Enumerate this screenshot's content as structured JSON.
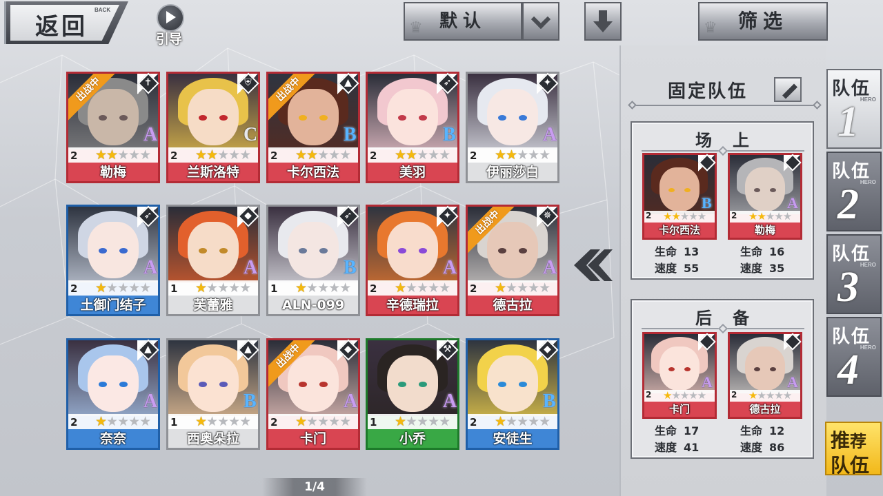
{
  "topbar": {
    "back_label": "返回",
    "back_sub": "BACK",
    "guide_label": "引导",
    "sort_label": "默认",
    "filter_label": "筛选"
  },
  "roster": [
    {
      "name": "勒梅",
      "level": "2",
      "stars": 2,
      "rank": "A",
      "frame": "red",
      "deployed": true,
      "class_icon": "cross-icon",
      "hair": "#8a8a8a",
      "skin": "#c9b7a8",
      "eye": "#6b5a5a"
    },
    {
      "name": "兰斯洛特",
      "level": "2",
      "stars": 2,
      "rank": "C",
      "frame": "red",
      "deployed": false,
      "class_icon": "shield-icon",
      "hair": "#e8c24a",
      "skin": "#f6dcc6",
      "eye": "#c2272d"
    },
    {
      "name": "卡尔西法",
      "level": "2",
      "stars": 2,
      "rank": "B",
      "frame": "red",
      "deployed": true,
      "class_icon": "witch-hat-icon",
      "hair": "#5a2a1e",
      "skin": "#e2b39a",
      "eye": "#f0b020"
    },
    {
      "name": "美羽",
      "level": "2",
      "stars": 2,
      "rank": "B",
      "frame": "red",
      "deployed": false,
      "class_icon": "bow-icon",
      "hair": "#f2c8cf",
      "skin": "#fbe3dd",
      "eye": "#c23a4a"
    },
    {
      "name": "伊丽莎白",
      "level": "2",
      "stars": 2,
      "rank": "A",
      "frame": "white",
      "deployed": false,
      "class_icon": "dagger-icon",
      "hair": "#e6e9f0",
      "skin": "#f7e8e4",
      "eye": "#3a7ad8"
    },
    {
      "name": "土御门结子",
      "level": "2",
      "stars": 1,
      "rank": "A",
      "frame": "blue",
      "deployed": false,
      "class_icon": "bow-icon",
      "hair": "#cfd6e4",
      "skin": "#f8e6e0",
      "eye": "#3a6ad0"
    },
    {
      "name": "芙蕾雅",
      "level": "1",
      "stars": 1,
      "rank": "A",
      "frame": "white",
      "deployed": false,
      "class_icon": "mask-icon",
      "hair": "#e2602c",
      "skin": "#f6dcc8",
      "eye": "#c28a2a"
    },
    {
      "name": "ALN-099",
      "level": "1",
      "stars": 1,
      "rank": "B",
      "frame": "white",
      "deployed": false,
      "class_icon": "bow-icon",
      "hair": "#e8e9ee",
      "skin": "#f4e6e2",
      "eye": "#6a7a9a"
    },
    {
      "name": "辛德瑞拉",
      "level": "2",
      "stars": 1,
      "rank": "A",
      "frame": "red",
      "deployed": false,
      "class_icon": "dagger-icon",
      "hair": "#e8782e",
      "skin": "#f8dccc",
      "eye": "#8a4ad8"
    },
    {
      "name": "德古拉",
      "level": "2",
      "stars": 1,
      "rank": "A",
      "frame": "red",
      "deployed": true,
      "class_icon": "shuriken-icon",
      "hair": "#d9d4d0",
      "skin": "#e6c8b8",
      "eye": "#5a4040"
    },
    {
      "name": "奈奈",
      "level": "2",
      "stars": 1,
      "rank": "A",
      "frame": "blue",
      "deployed": false,
      "class_icon": "witch-hat-icon",
      "hair": "#a9c6ec",
      "skin": "#fbe8e4",
      "eye": "#2a7ad8"
    },
    {
      "name": "西奥朵拉",
      "level": "1",
      "stars": 1,
      "rank": "B",
      "frame": "white",
      "deployed": false,
      "class_icon": "witch-hat-icon",
      "hair": "#f2c89a",
      "skin": "#fbe2d2",
      "eye": "#5a5ab8"
    },
    {
      "name": "卡门",
      "level": "2",
      "stars": 1,
      "rank": "A",
      "frame": "red",
      "deployed": true,
      "class_icon": "mask-icon",
      "hair": "#f0c8c0",
      "skin": "#fbe4dc",
      "eye": "#b8342e"
    },
    {
      "name": "小乔",
      "level": "1",
      "stars": 1,
      "rank": "A",
      "frame": "green",
      "deployed": false,
      "class_icon": "hammer-icon",
      "hair": "#2a2422",
      "skin": "#f2dccc",
      "eye": "#2a9a7a"
    },
    {
      "name": "安徒生",
      "level": "2",
      "stars": 1,
      "rank": "B",
      "frame": "blue",
      "deployed": false,
      "class_icon": "mask-icon",
      "hair": "#f2d24a",
      "skin": "#f8e2cc",
      "eye": "#2a8ad8"
    }
  ],
  "deployed_badge": "出战中",
  "pager": "1/4",
  "team": {
    "title": "固定队伍",
    "field_header": "场上",
    "reserve_header": "后备",
    "hp_label": "生命",
    "speed_label": "速度",
    "field": [
      {
        "name": "卡尔西法",
        "level": "2",
        "stars": 2,
        "rank": "B",
        "hp": "13",
        "speed": "55",
        "hair": "#5a2a1e",
        "skin": "#e2b39a",
        "eye": "#f0b020"
      },
      {
        "name": "勒梅",
        "level": "2",
        "stars": 2,
        "rank": "A",
        "hp": "16",
        "speed": "35",
        "hair": "#b5b5b8",
        "skin": "#e0d0c6",
        "eye": "#6b5a5a"
      }
    ],
    "reserve": [
      {
        "name": "卡门",
        "level": "2",
        "stars": 1,
        "rank": "A",
        "hp": "17",
        "speed": "41",
        "hair": "#f0c8c0",
        "skin": "#fbe4dc",
        "eye": "#b8342e"
      },
      {
        "name": "德古拉",
        "level": "2",
        "stars": 1,
        "rank": "A",
        "hp": "12",
        "speed": "86",
        "hair": "#d9d4d0",
        "skin": "#e6c8b8",
        "eye": "#5a4040"
      }
    ]
  },
  "tabs": [
    {
      "label": "队伍",
      "sub": "HERO",
      "num": "1",
      "active": true
    },
    {
      "label": "队伍",
      "sub": "HERO",
      "num": "2",
      "active": false
    },
    {
      "label": "队伍",
      "sub": "HERO",
      "num": "3",
      "active": false
    },
    {
      "label": "队伍",
      "sub": "HERO",
      "num": "4",
      "active": false
    }
  ],
  "recommend": {
    "line1a": "推",
    "line1b": "荐",
    "line2": "队伍"
  }
}
